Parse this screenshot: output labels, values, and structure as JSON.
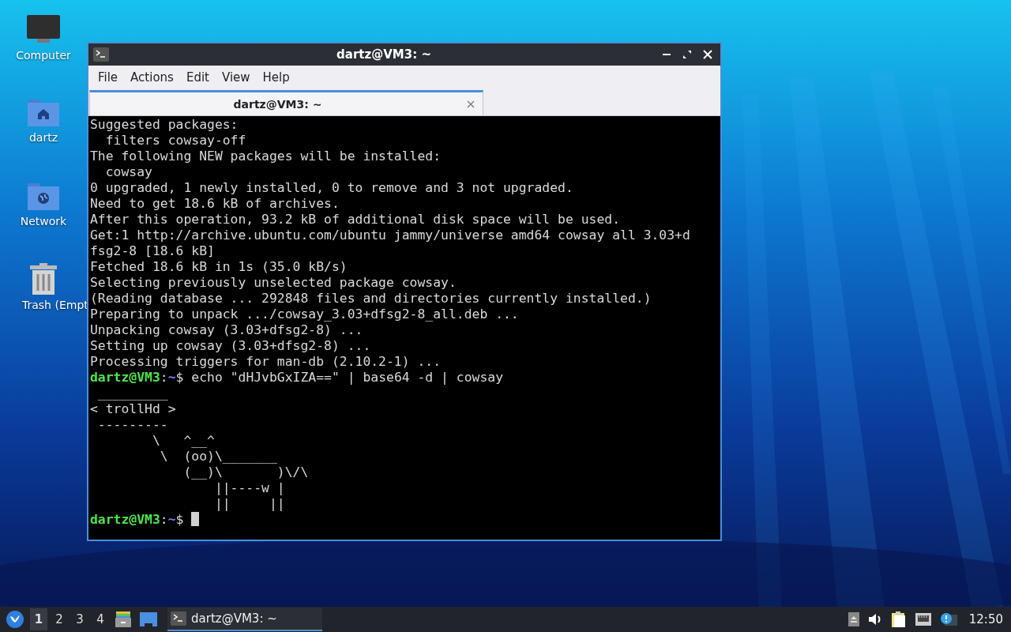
{
  "desktop": {
    "icons": [
      {
        "kind": "computer",
        "label": "Computer"
      },
      {
        "kind": "home",
        "label": "dartz"
      },
      {
        "kind": "network",
        "label": "Network"
      },
      {
        "kind": "trash",
        "label": "Trash (Empt"
      }
    ]
  },
  "window": {
    "title": "dartz@VM3: ~",
    "menu": [
      "File",
      "Actions",
      "Edit",
      "View",
      "Help"
    ],
    "tabs": [
      {
        "label": "dartz@VM3: ~",
        "selected": true
      }
    ],
    "terminal": {
      "lines": [
        {
          "kind": "output",
          "text": "Suggested packages:"
        },
        {
          "kind": "output",
          "text": "  filters cowsay-off"
        },
        {
          "kind": "output",
          "text": "The following NEW packages will be installed:"
        },
        {
          "kind": "output",
          "text": "  cowsay"
        },
        {
          "kind": "output",
          "text": "0 upgraded, 1 newly installed, 0 to remove and 3 not upgraded."
        },
        {
          "kind": "output",
          "text": "Need to get 18.6 kB of archives."
        },
        {
          "kind": "output",
          "text": "After this operation, 93.2 kB of additional disk space will be used."
        },
        {
          "kind": "output",
          "text": "Get:1 http://archive.ubuntu.com/ubuntu jammy/universe amd64 cowsay all 3.03+d"
        },
        {
          "kind": "output",
          "text": "fsg2-8 [18.6 kB]"
        },
        {
          "kind": "output",
          "text": "Fetched 18.6 kB in 1s (35.0 kB/s)"
        },
        {
          "kind": "output",
          "text": "Selecting previously unselected package cowsay."
        },
        {
          "kind": "output",
          "text": "(Reading database ... 292848 files and directories currently installed.)"
        },
        {
          "kind": "output",
          "text": "Preparing to unpack .../cowsay_3.03+dfsg2-8_all.deb ..."
        },
        {
          "kind": "output",
          "text": "Unpacking cowsay (3.03+dfsg2-8) ..."
        },
        {
          "kind": "output",
          "text": "Setting up cowsay (3.03+dfsg2-8) ..."
        },
        {
          "kind": "output",
          "text": "Processing triggers for man-db (2.10.2-1) ..."
        },
        {
          "kind": "prompt",
          "user": "dartz@VM3",
          "sep": ":",
          "path": "~",
          "symbol": "$",
          "command": "echo \"dHJvbGxIZA==\" | base64 -d | cowsay",
          "cursor": false
        },
        {
          "kind": "output",
          "text": " _________"
        },
        {
          "kind": "output",
          "text": "< trollHd >"
        },
        {
          "kind": "output",
          "text": " ---------"
        },
        {
          "kind": "output",
          "text": "        \\   ^__^"
        },
        {
          "kind": "output",
          "text": "         \\  (oo)\\_______"
        },
        {
          "kind": "output",
          "text": "            (__)\\       )\\/\\"
        },
        {
          "kind": "output",
          "text": "                ||----w |"
        },
        {
          "kind": "output",
          "text": "                ||     ||"
        },
        {
          "kind": "prompt",
          "user": "dartz@VM3",
          "sep": ":",
          "path": "~",
          "symbol": "$",
          "cursor": true
        }
      ]
    }
  },
  "taskbar": {
    "workspaces": [
      {
        "label": "1",
        "selected": true
      },
      {
        "label": "2",
        "selected": false
      },
      {
        "label": "3",
        "selected": false
      },
      {
        "label": "4",
        "selected": false
      }
    ],
    "tasks": [
      {
        "label": "dartz@VM3: ~",
        "selected": true
      }
    ],
    "clock": "12:50"
  }
}
